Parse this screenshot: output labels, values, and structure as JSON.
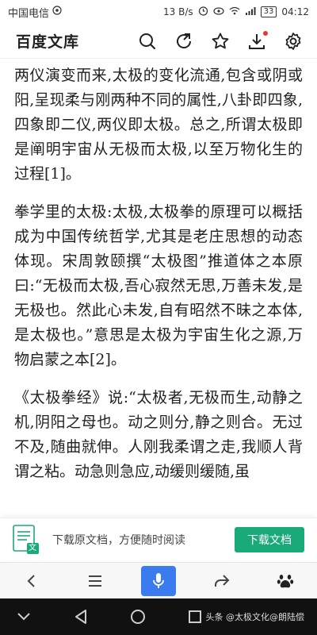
{
  "status_bar": {
    "carrier": "中国电信",
    "speed": "13 B/s",
    "battery": "33",
    "time": "04:12"
  },
  "header": {
    "title": "百度文库"
  },
  "content": {
    "paragraphs": [
      "两仪演变而来,太极的变化流通,包含或阴或阳,呈现柔与刚两种不同的属性,八卦即四象,四象即二仪,两仪即太极。总之,所谓太极即是阐明宇宙从无极而太极,以至万物化生的过程[1]。",
      "拳学里的太极:太极,太极拳的原理可以概括成为中国传统哲学,尤其是老庄思想的动态体现。宋周敦颐撰“太极图”推道体之本原曰:“无极而太极,吾心寂然无思,万善未发,是无极也。然此心未发,自有昭然不昧之本体,是太极也。”意思是太极为宇宙生化之源,万物启蒙之本[2]。",
      "《太极拳经》说:“太极者,无极而生,动静之机,阴阳之母也。动之则分,静之则合。无过不及,随曲就伸。人刚我柔谓之走,我顺人背谓之粘。动急则急应,动缓则缓随,虽"
    ]
  },
  "download_banner": {
    "text": "下载原文档，方便随时阅读",
    "button_label": "下载文档",
    "icon_badge": "文"
  },
  "watermark": "头条 @太极文化@朗陆偿",
  "colors": {
    "accent_green": "#1aaa7a",
    "mic_blue": "#3a7bf0",
    "notification_red": "#e53935"
  }
}
